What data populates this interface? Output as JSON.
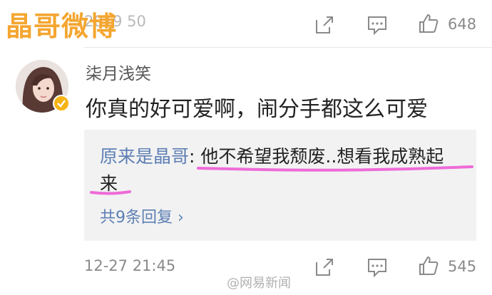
{
  "brand": "晶哥微博",
  "top_bar": {
    "time": "2019 50",
    "like_count": "648"
  },
  "comment": {
    "username": "柒月浅笑",
    "text": "你真的好可爱啊，闹分手都这么可爱",
    "reply": {
      "author": "原来是晶哥",
      "separator": ": ",
      "text_line1": "他不希望我颓废..想看我成熟起",
      "text_line2": "来",
      "more_label": "共9条回复 ›"
    },
    "time": "12-27 21:45",
    "like_count": "545"
  },
  "footer_watermark": "@网易新闻",
  "colors": {
    "link": "#5d7fb4",
    "brand": "#f4a630",
    "highlight": "#ee6bd8",
    "badge": "#f7b313"
  }
}
